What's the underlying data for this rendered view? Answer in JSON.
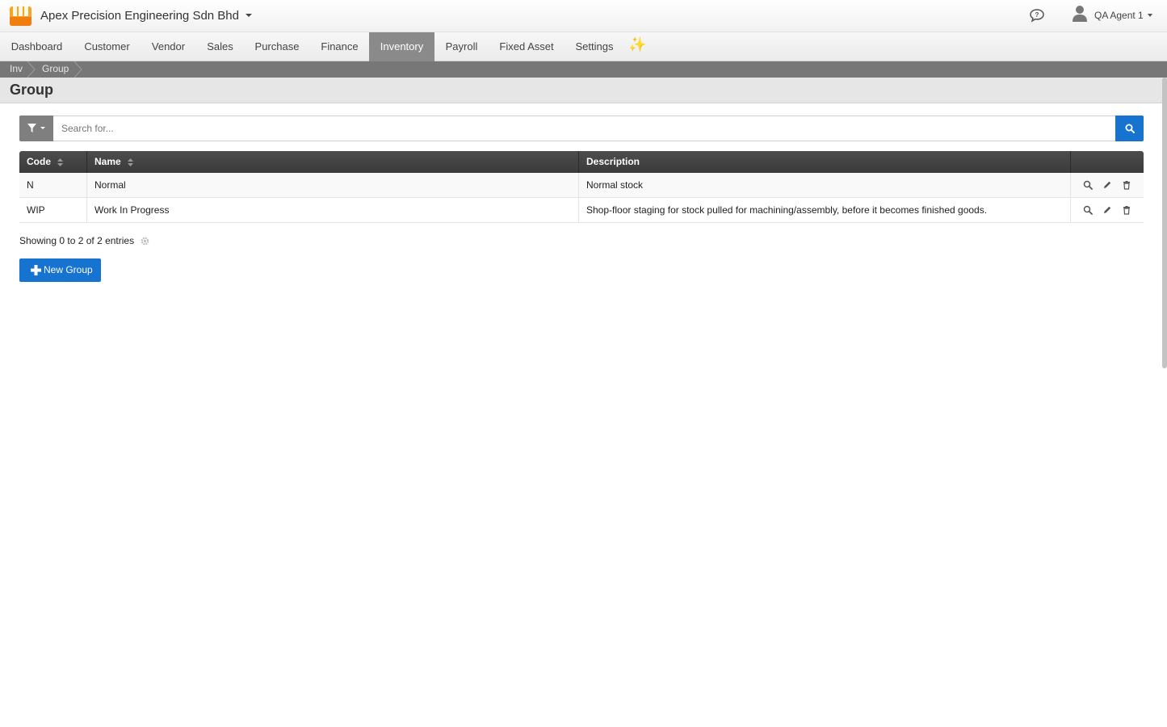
{
  "app": {
    "company_name": "Apex Precision Engineering Sdn Bhd",
    "user_name": "QA Agent 1",
    "brand_color": "#f5a623",
    "accent_color": "#1673d0"
  },
  "nav": {
    "items": [
      {
        "label": "Dashboard",
        "active": false
      },
      {
        "label": "Customer",
        "active": false
      },
      {
        "label": "Vendor",
        "active": false
      },
      {
        "label": "Sales",
        "active": false
      },
      {
        "label": "Purchase",
        "active": false
      },
      {
        "label": "Finance",
        "active": false
      },
      {
        "label": "Inventory",
        "active": true
      },
      {
        "label": "Payroll",
        "active": false
      },
      {
        "label": "Fixed Asset",
        "active": false
      },
      {
        "label": "Settings",
        "active": false
      }
    ],
    "sparkle": "✨"
  },
  "breadcrumb": [
    "Inv",
    "Group"
  ],
  "page": {
    "title": "Group"
  },
  "search": {
    "placeholder": "Search for...",
    "value": ""
  },
  "table": {
    "columns": [
      "Code",
      "Name",
      "Description"
    ],
    "rows": [
      {
        "code": "N",
        "name": "Normal",
        "description": "Normal stock"
      },
      {
        "code": "WIP",
        "name": "Work In Progress",
        "description": "Shop-floor staging for stock pulled for machining/assembly, before it becomes finished goods."
      }
    ],
    "row_actions": [
      "search-icon",
      "pencil-icon",
      "trash-icon"
    ]
  },
  "footer": {
    "info": "Showing 0 to 2 of 2 entries",
    "new_button": "New Group"
  }
}
